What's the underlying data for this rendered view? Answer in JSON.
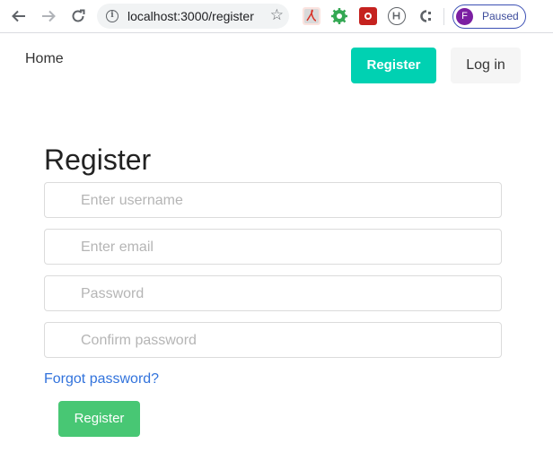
{
  "browser": {
    "url": "localhost:3000/register",
    "profile_initial": "F",
    "profile_status": "Paused"
  },
  "nav": {
    "home_label": "Home",
    "register_label": "Register",
    "login_label": "Log in"
  },
  "form": {
    "title": "Register",
    "username_placeholder": "Enter username",
    "email_placeholder": "Enter email",
    "password_placeholder": "Password",
    "confirm_placeholder": "Confirm password",
    "forgot_label": "Forgot password?",
    "submit_label": "Register"
  },
  "colors": {
    "primary": "#00d1b2",
    "success": "#48c774",
    "link": "#3273dc"
  }
}
